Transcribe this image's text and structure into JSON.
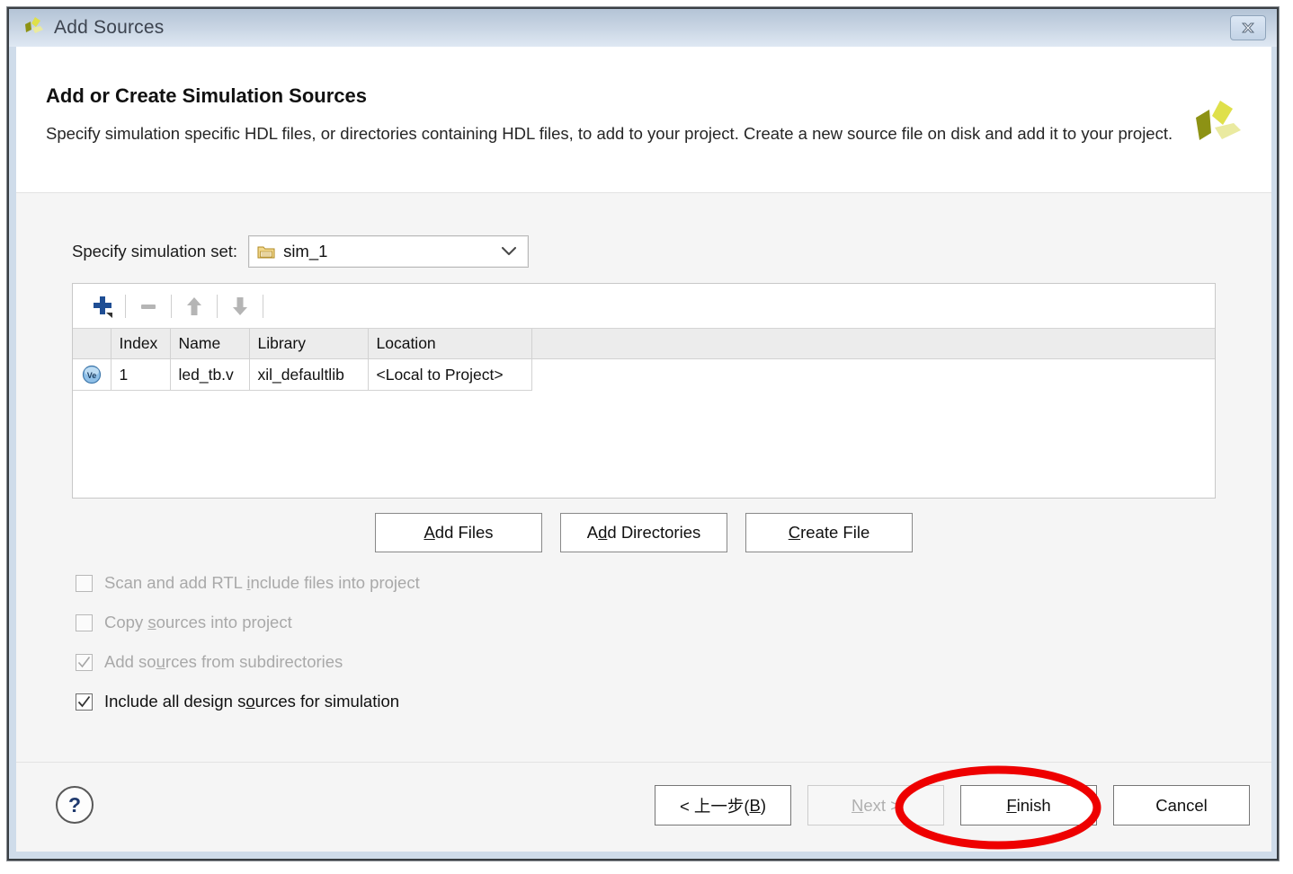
{
  "window": {
    "title": "Add Sources",
    "logo_icon": "xilinx-logo-icon",
    "close_icon": "close-icon"
  },
  "header": {
    "title": "Add or Create Simulation Sources",
    "description": "Specify simulation specific HDL files, or directories containing HDL files, to add to your project. Create a new source file on disk and add it to your project.",
    "logo_icon": "xilinx-logo-icon"
  },
  "simulation_set": {
    "label": "Specify simulation set:",
    "value": "sim_1",
    "folder_icon": "folder-icon",
    "chevron_icon": "chevron-down-icon"
  },
  "toolbar": {
    "add_icon": "plus-icon",
    "remove_icon": "minus-icon",
    "move_up_icon": "arrow-up-icon",
    "move_down_icon": "arrow-down-icon"
  },
  "sources_table": {
    "columns": [
      "",
      "Index",
      "Name",
      "Library",
      "Location",
      ""
    ],
    "rows": [
      {
        "icon": "verilog-file-icon",
        "index": "1",
        "name": "led_tb.v",
        "library": "xil_defaultlib",
        "location": "<Local to Project>"
      }
    ]
  },
  "file_buttons": [
    {
      "label_before": "A",
      "mnemonic": "",
      "label": "Add Files",
      "pre": "",
      "mn": "A",
      "post": "dd Files"
    },
    {
      "label": "Add Directories",
      "pre": "A",
      "mn": "d",
      "post": "d Directories"
    },
    {
      "label": "Create File",
      "pre": "",
      "mn": "C",
      "post": "reate File"
    }
  ],
  "checkboxes": [
    {
      "label": "Scan and add RTL include files into project",
      "pre": "Scan and add RTL ",
      "mn": "i",
      "post": "nclude files into project",
      "checked": false,
      "enabled": false
    },
    {
      "label": "Copy sources into project",
      "pre": "Copy ",
      "mn": "s",
      "post": "ources into project",
      "checked": false,
      "enabled": false
    },
    {
      "label": "Add sources from subdirectories",
      "pre": "Add so",
      "mn": "u",
      "post": "rces from subdirectories",
      "checked": true,
      "enabled": false
    },
    {
      "label": "Include all design sources for simulation",
      "pre": "Include all design s",
      "mn": "o",
      "post": "urces for simulation",
      "checked": true,
      "enabled": true
    }
  ],
  "footer": {
    "help_label": "?",
    "buttons": [
      {
        "label": "< 上一步(B)",
        "pre": "< 上一步(",
        "mn": "B",
        "post": ")",
        "enabled": true
      },
      {
        "label": "Next >",
        "pre": "",
        "mn": "N",
        "post": "ext >",
        "enabled": false
      },
      {
        "label": "Finish",
        "pre": "",
        "mn": "F",
        "post": "inish",
        "enabled": true
      },
      {
        "label": "Cancel",
        "pre": "Cancel",
        "mn": "",
        "post": "",
        "enabled": true
      }
    ]
  },
  "annotation": {
    "shape": "ellipse",
    "target": "Finish",
    "color": "#ee0000"
  }
}
